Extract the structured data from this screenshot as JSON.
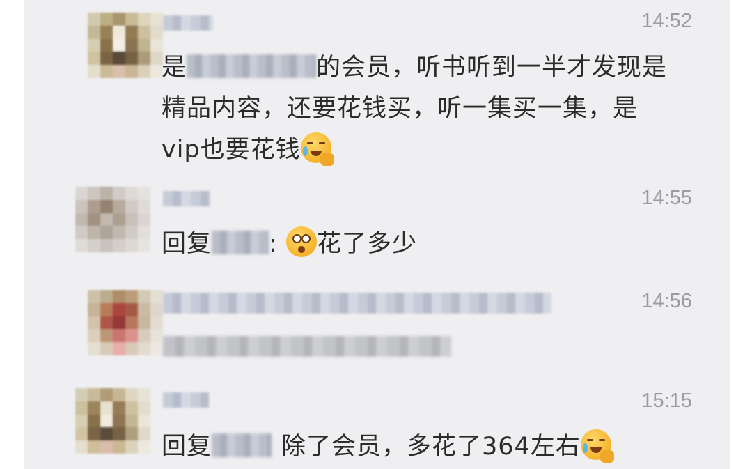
{
  "messages": [
    {
      "time": "14:52",
      "line1_prefix": "是",
      "line1_suffix": "的会员，听书听到一半才发现是",
      "line2": "精品内容，还要花钱买，听一集买一集，是",
      "line3": "vip也要花钱",
      "emoji": "crying-face-emoji"
    },
    {
      "time": "14:55",
      "prefix": "回复",
      "colon": ":",
      "emoji": "astonished-face-emoji",
      "text": "花了多少"
    },
    {
      "time": "14:56"
    },
    {
      "time": "15:15",
      "prefix": "回复",
      "text": "除了会员，多花了364左右",
      "emoji": "crying-face-emoji"
    }
  ]
}
